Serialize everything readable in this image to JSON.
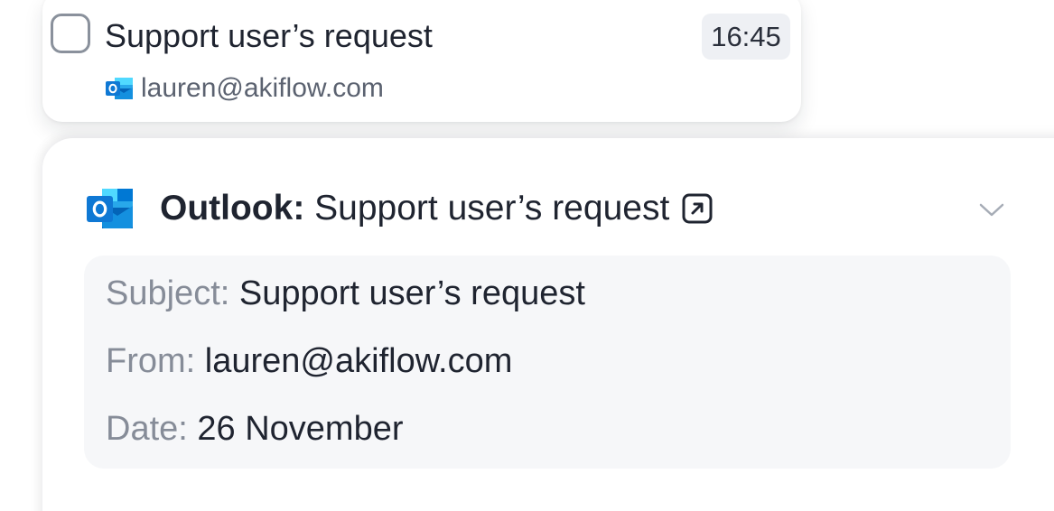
{
  "task": {
    "title": "Support user’s request",
    "time": "16:45",
    "source_email": "lauren@akiflow.com",
    "source_icon": "outlook-icon"
  },
  "detail": {
    "app_name": "Outlook:",
    "title": "Support user’s request",
    "icons": {
      "app": "outlook-icon",
      "open": "external-link-icon",
      "expand": "chevron-down-icon"
    },
    "fields": {
      "subject_label": "Subject:",
      "subject_value": "Support user’s request",
      "from_label": "From:",
      "from_value": "lauren@akiflow.com",
      "date_label": "Date:",
      "date_value": "26 November"
    }
  },
  "colors": {
    "outlook_blue": "#0f78d4",
    "outlook_dark": "#0b5aa6",
    "text_primary": "#1f2430",
    "text_muted": "#868c98",
    "time_badge_bg": "#eef0f4",
    "meta_box_bg": "#f6f7f9"
  }
}
